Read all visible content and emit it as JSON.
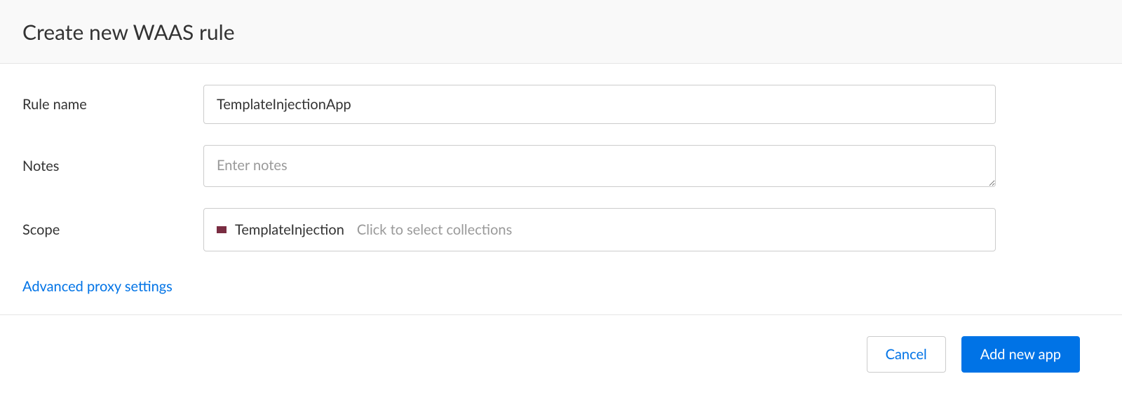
{
  "header": {
    "title": "Create new WAAS rule"
  },
  "form": {
    "rule_name": {
      "label": "Rule name",
      "value": "TemplateInjectionApp"
    },
    "notes": {
      "label": "Notes",
      "placeholder": "Enter notes",
      "value": ""
    },
    "scope": {
      "label": "Scope",
      "selected_chip": {
        "swatch_color": "#7a2d42",
        "label": "TemplateInjection"
      },
      "placeholder": "Click to select collections"
    },
    "advanced_link": "Advanced proxy settings"
  },
  "footer": {
    "cancel_label": "Cancel",
    "add_label": "Add new app"
  }
}
